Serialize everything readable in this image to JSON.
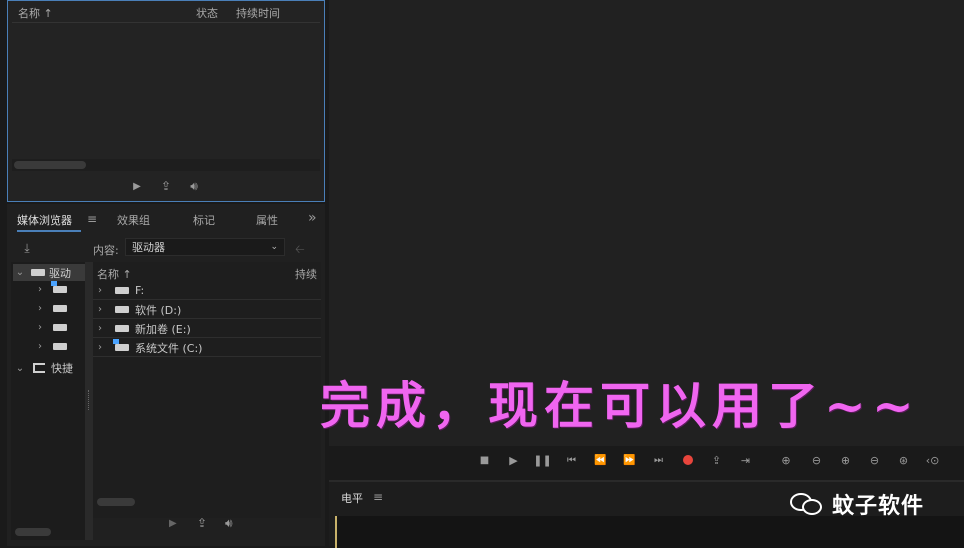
{
  "project_panel": {
    "col_name": "名称 ↑",
    "col_status": "状态",
    "col_duration": "持续时间"
  },
  "tabs": {
    "media_browser": "媒体浏览器",
    "menu_glyph": "≡",
    "effects": "效果组",
    "markers": "标记",
    "properties": "属性",
    "more": "»"
  },
  "media_browser": {
    "content_label": "内容:",
    "content_value": "驱动器",
    "tree_drives": "驱动",
    "tree_favorites": "快捷",
    "list_header_name": "名称 ↑",
    "list_header_duration": "持续",
    "drives": [
      {
        "label": "F:"
      },
      {
        "label": "软件 (D:)"
      },
      {
        "label": "新加卷 (E:)"
      },
      {
        "label": "系统文件 (C:)"
      }
    ]
  },
  "audio_panel": {
    "title": "电平",
    "menu_glyph": "≡"
  },
  "subtitle": {
    "text": "完成，现在可以用了~~"
  },
  "watermark": {
    "text": "蚊子软件"
  },
  "colors": {
    "accent_blue": "#4a7fb8",
    "record_red": "#e8453c",
    "subtitle_magenta": "#f065f0"
  }
}
